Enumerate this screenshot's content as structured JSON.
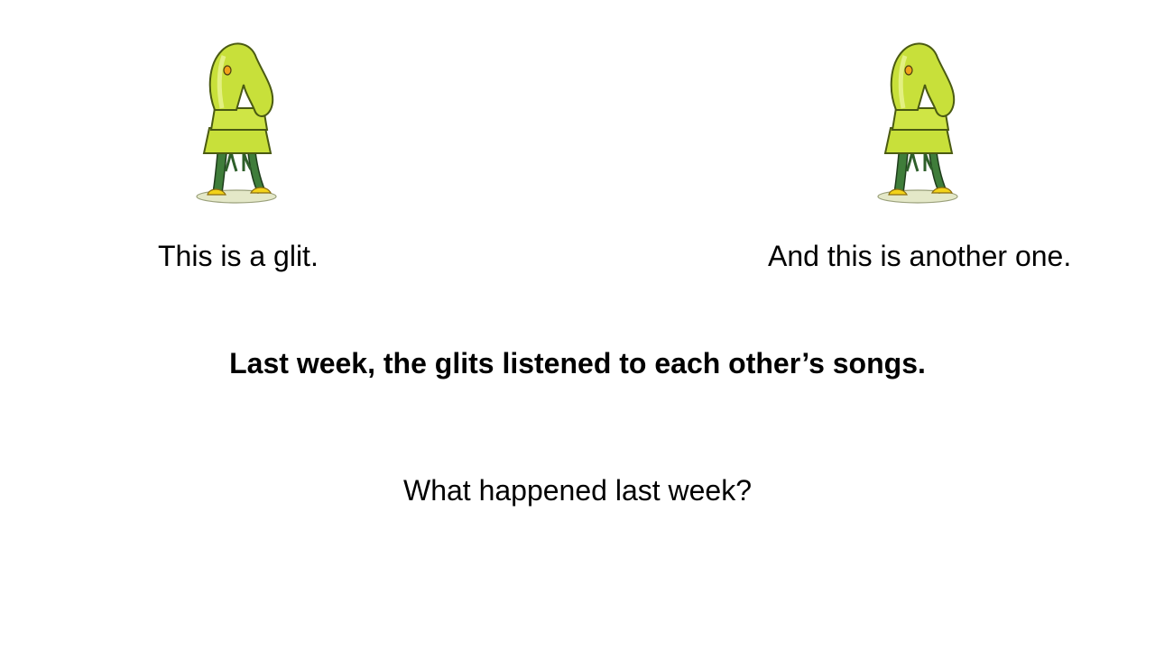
{
  "slide": {
    "caption_left": "This is a glit.",
    "caption_right": "And this is another one.",
    "statement": "Last week, the glits listened to each other’s songs.",
    "question": "What happened last week?"
  },
  "illustration": {
    "left_icon": "glit-creature-icon",
    "right_icon": "glit-creature-icon",
    "body_color": "#c8e03a",
    "leg_color": "#3f7d3a",
    "foot_color": "#f2d21a"
  }
}
